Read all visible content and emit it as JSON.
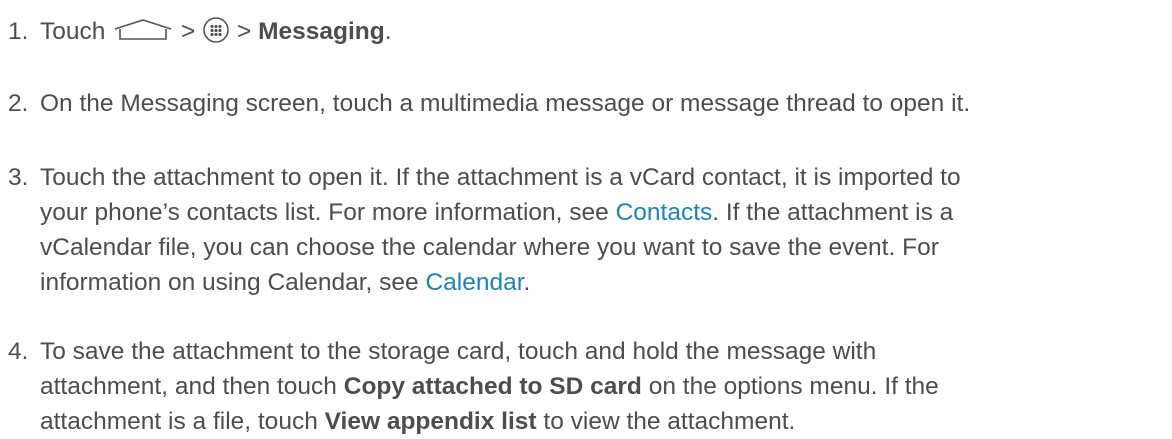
{
  "steps": [
    {
      "number": "1.",
      "parts": {
        "prefix": "Touch ",
        "sep1": " > ",
        "sep2": " > ",
        "bold": "Messaging",
        "suffix": "."
      },
      "icons": [
        "home-icon",
        "apps-icon"
      ]
    },
    {
      "number": "2.",
      "lines": [
        "On the Messaging screen, touch a multimedia message or message thread to open it."
      ]
    },
    {
      "number": "3.",
      "l1": "Touch the attachment to open it. If the attachment is a vCard contact, it is imported to",
      "l2a": "your phone’s contacts list. For more information, see ",
      "l2link": "Contacts",
      "l2b": ". If the attachment is a",
      "l3": "vCalendar file, you can choose the calendar where you want to save the event. For",
      "l4a": "information on using Calendar, see ",
      "l4link": "Calendar",
      "l4b": "."
    },
    {
      "number": "4.",
      "l1": "To save the attachment to the storage card, touch and hold the message with",
      "l2a": "attachment, and then touch ",
      "l2bold": "Copy attached to SD card",
      "l2b": " on the options menu. If the",
      "l3a": "attachment is a file, touch ",
      "l3bold": "View appendix list",
      "l3b": " to view the attachment."
    }
  ],
  "colors": {
    "text": "#4d4d4d",
    "link": "#1c84b8"
  }
}
